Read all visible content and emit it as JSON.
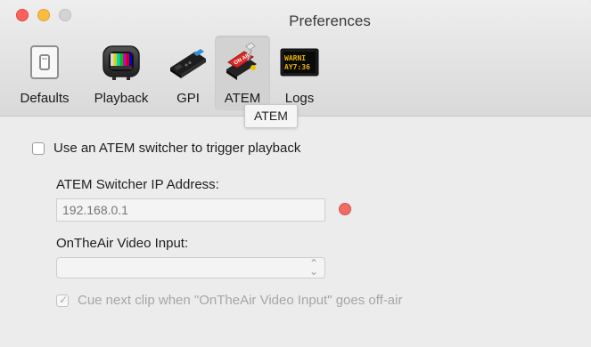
{
  "window": {
    "title": "Preferences"
  },
  "toolbar": {
    "items": [
      {
        "label": "Defaults",
        "icon": "defaults-icon"
      },
      {
        "label": "Playback",
        "icon": "playback-icon"
      },
      {
        "label": "GPI",
        "icon": "gpi-icon"
      },
      {
        "label": "ATEM",
        "icon": "atem-icon",
        "selected": true
      },
      {
        "label": "Logs",
        "icon": "logs-icon"
      }
    ],
    "tooltip": "ATEM"
  },
  "atem": {
    "use_switcher_label": "Use an ATEM switcher to trigger playback",
    "use_switcher_checked": false,
    "ip_label": "ATEM Switcher IP Address:",
    "ip_placeholder": "192.168.0.1",
    "status_color": "#ef6b64",
    "video_input_label": "OnTheAir Video Input:",
    "video_input_value": "",
    "cue_next_label": "Cue next clip when \"OnTheAir Video Input\" goes off-air",
    "cue_next_checked": true
  },
  "colors": {
    "close": "#fc615d",
    "minimize": "#fdbc40",
    "zoom": "#d3d3d3"
  }
}
